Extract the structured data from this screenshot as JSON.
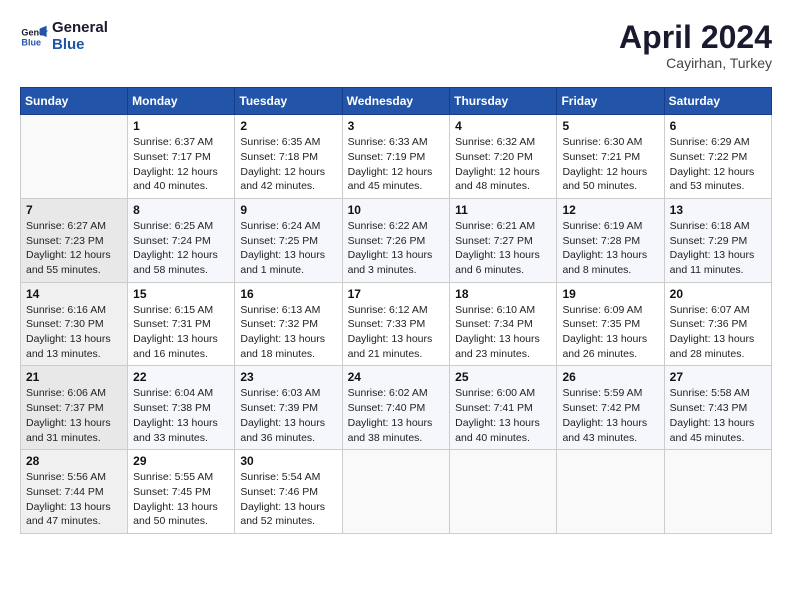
{
  "header": {
    "logo_line1": "General",
    "logo_line2": "Blue",
    "month_year": "April 2024",
    "location": "Cayirhan, Turkey"
  },
  "weekdays": [
    "Sunday",
    "Monday",
    "Tuesday",
    "Wednesday",
    "Thursday",
    "Friday",
    "Saturday"
  ],
  "weeks": [
    [
      {
        "day": "",
        "sunrise": "",
        "sunset": "",
        "daylight": ""
      },
      {
        "day": "1",
        "sunrise": "Sunrise: 6:37 AM",
        "sunset": "Sunset: 7:17 PM",
        "daylight": "Daylight: 12 hours and 40 minutes."
      },
      {
        "day": "2",
        "sunrise": "Sunrise: 6:35 AM",
        "sunset": "Sunset: 7:18 PM",
        "daylight": "Daylight: 12 hours and 42 minutes."
      },
      {
        "day": "3",
        "sunrise": "Sunrise: 6:33 AM",
        "sunset": "Sunset: 7:19 PM",
        "daylight": "Daylight: 12 hours and 45 minutes."
      },
      {
        "day": "4",
        "sunrise": "Sunrise: 6:32 AM",
        "sunset": "Sunset: 7:20 PM",
        "daylight": "Daylight: 12 hours and 48 minutes."
      },
      {
        "day": "5",
        "sunrise": "Sunrise: 6:30 AM",
        "sunset": "Sunset: 7:21 PM",
        "daylight": "Daylight: 12 hours and 50 minutes."
      },
      {
        "day": "6",
        "sunrise": "Sunrise: 6:29 AM",
        "sunset": "Sunset: 7:22 PM",
        "daylight": "Daylight: 12 hours and 53 minutes."
      }
    ],
    [
      {
        "day": "7",
        "sunrise": "Sunrise: 6:27 AM",
        "sunset": "Sunset: 7:23 PM",
        "daylight": "Daylight: 12 hours and 55 minutes."
      },
      {
        "day": "8",
        "sunrise": "Sunrise: 6:25 AM",
        "sunset": "Sunset: 7:24 PM",
        "daylight": "Daylight: 12 hours and 58 minutes."
      },
      {
        "day": "9",
        "sunrise": "Sunrise: 6:24 AM",
        "sunset": "Sunset: 7:25 PM",
        "daylight": "Daylight: 13 hours and 1 minute."
      },
      {
        "day": "10",
        "sunrise": "Sunrise: 6:22 AM",
        "sunset": "Sunset: 7:26 PM",
        "daylight": "Daylight: 13 hours and 3 minutes."
      },
      {
        "day": "11",
        "sunrise": "Sunrise: 6:21 AM",
        "sunset": "Sunset: 7:27 PM",
        "daylight": "Daylight: 13 hours and 6 minutes."
      },
      {
        "day": "12",
        "sunrise": "Sunrise: 6:19 AM",
        "sunset": "Sunset: 7:28 PM",
        "daylight": "Daylight: 13 hours and 8 minutes."
      },
      {
        "day": "13",
        "sunrise": "Sunrise: 6:18 AM",
        "sunset": "Sunset: 7:29 PM",
        "daylight": "Daylight: 13 hours and 11 minutes."
      }
    ],
    [
      {
        "day": "14",
        "sunrise": "Sunrise: 6:16 AM",
        "sunset": "Sunset: 7:30 PM",
        "daylight": "Daylight: 13 hours and 13 minutes."
      },
      {
        "day": "15",
        "sunrise": "Sunrise: 6:15 AM",
        "sunset": "Sunset: 7:31 PM",
        "daylight": "Daylight: 13 hours and 16 minutes."
      },
      {
        "day": "16",
        "sunrise": "Sunrise: 6:13 AM",
        "sunset": "Sunset: 7:32 PM",
        "daylight": "Daylight: 13 hours and 18 minutes."
      },
      {
        "day": "17",
        "sunrise": "Sunrise: 6:12 AM",
        "sunset": "Sunset: 7:33 PM",
        "daylight": "Daylight: 13 hours and 21 minutes."
      },
      {
        "day": "18",
        "sunrise": "Sunrise: 6:10 AM",
        "sunset": "Sunset: 7:34 PM",
        "daylight": "Daylight: 13 hours and 23 minutes."
      },
      {
        "day": "19",
        "sunrise": "Sunrise: 6:09 AM",
        "sunset": "Sunset: 7:35 PM",
        "daylight": "Daylight: 13 hours and 26 minutes."
      },
      {
        "day": "20",
        "sunrise": "Sunrise: 6:07 AM",
        "sunset": "Sunset: 7:36 PM",
        "daylight": "Daylight: 13 hours and 28 minutes."
      }
    ],
    [
      {
        "day": "21",
        "sunrise": "Sunrise: 6:06 AM",
        "sunset": "Sunset: 7:37 PM",
        "daylight": "Daylight: 13 hours and 31 minutes."
      },
      {
        "day": "22",
        "sunrise": "Sunrise: 6:04 AM",
        "sunset": "Sunset: 7:38 PM",
        "daylight": "Daylight: 13 hours and 33 minutes."
      },
      {
        "day": "23",
        "sunrise": "Sunrise: 6:03 AM",
        "sunset": "Sunset: 7:39 PM",
        "daylight": "Daylight: 13 hours and 36 minutes."
      },
      {
        "day": "24",
        "sunrise": "Sunrise: 6:02 AM",
        "sunset": "Sunset: 7:40 PM",
        "daylight": "Daylight: 13 hours and 38 minutes."
      },
      {
        "day": "25",
        "sunrise": "Sunrise: 6:00 AM",
        "sunset": "Sunset: 7:41 PM",
        "daylight": "Daylight: 13 hours and 40 minutes."
      },
      {
        "day": "26",
        "sunrise": "Sunrise: 5:59 AM",
        "sunset": "Sunset: 7:42 PM",
        "daylight": "Daylight: 13 hours and 43 minutes."
      },
      {
        "day": "27",
        "sunrise": "Sunrise: 5:58 AM",
        "sunset": "Sunset: 7:43 PM",
        "daylight": "Daylight: 13 hours and 45 minutes."
      }
    ],
    [
      {
        "day": "28",
        "sunrise": "Sunrise: 5:56 AM",
        "sunset": "Sunset: 7:44 PM",
        "daylight": "Daylight: 13 hours and 47 minutes."
      },
      {
        "day": "29",
        "sunrise": "Sunrise: 5:55 AM",
        "sunset": "Sunset: 7:45 PM",
        "daylight": "Daylight: 13 hours and 50 minutes."
      },
      {
        "day": "30",
        "sunrise": "Sunrise: 5:54 AM",
        "sunset": "Sunset: 7:46 PM",
        "daylight": "Daylight: 13 hours and 52 minutes."
      },
      {
        "day": "",
        "sunrise": "",
        "sunset": "",
        "daylight": ""
      },
      {
        "day": "",
        "sunrise": "",
        "sunset": "",
        "daylight": ""
      },
      {
        "day": "",
        "sunrise": "",
        "sunset": "",
        "daylight": ""
      },
      {
        "day": "",
        "sunrise": "",
        "sunset": "",
        "daylight": ""
      }
    ]
  ]
}
